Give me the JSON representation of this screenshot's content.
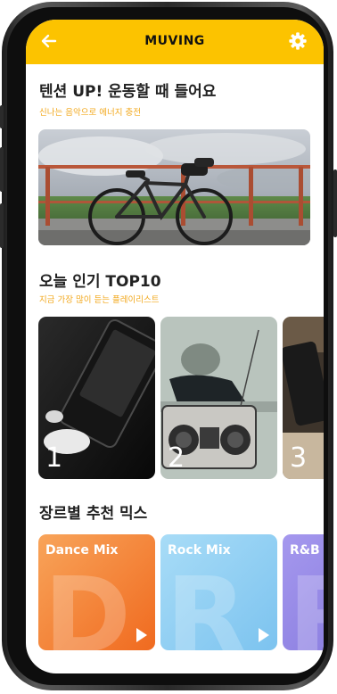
{
  "header": {
    "title": "MUVING",
    "back_icon": "arrow-left-icon",
    "settings_icon": "gear-icon"
  },
  "colors": {
    "accent": "#fcc300",
    "subtitle": "#f2a81d"
  },
  "workout": {
    "title": "텐션 UP! 운동할 때 들어요",
    "subtitle": "신나는 음악으로 에너지 충전"
  },
  "top10": {
    "title": "오늘 인기 TOP10",
    "subtitle": "지금 가장 많이 듣는 플레이리스트",
    "items": [
      {
        "rank": "1"
      },
      {
        "rank": "2"
      },
      {
        "rank": "3"
      }
    ]
  },
  "genre": {
    "title": "장르별 추천 믹스",
    "items": [
      {
        "name": "Dance Mix",
        "letter": "D",
        "color": "#f57f2a"
      },
      {
        "name": "Rock Mix",
        "letter": "R",
        "color": "#9ed5f5"
      },
      {
        "name": "R&B Mix",
        "letter": "R",
        "color": "#9b8de8"
      }
    ]
  }
}
